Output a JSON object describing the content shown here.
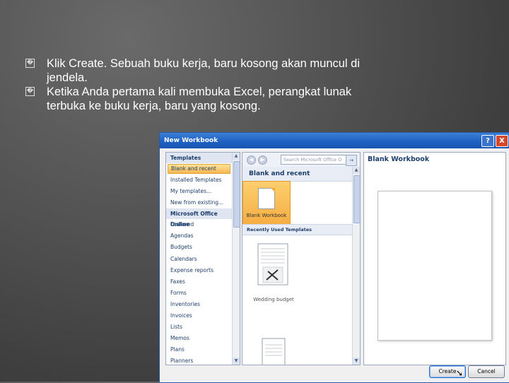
{
  "slide": {
    "bullets": [
      "Klik Create. Sebuah buku kerja, baru kosong akan muncul di jendela.",
      "Ketika Anda pertama kali membuka Excel, perangkat lunak terbuka ke buku kerja, baru yang kosong."
    ],
    "bullet_glyph": "�"
  },
  "dialog": {
    "title": "New Workbook",
    "help_label": "?",
    "close_label": "X",
    "templates": {
      "header": "Templates",
      "items": [
        {
          "label": "Blank and recent",
          "selected": true
        },
        {
          "label": "Installed Templates"
        },
        {
          "label": "My templates..."
        },
        {
          "label": "New from existing..."
        }
      ],
      "online_header": "Microsoft Office Online",
      "online_items": [
        "Featured",
        "Agendas",
        "Budgets",
        "Calendars",
        "Expense reports",
        "Faxes",
        "Forms",
        "Inventories",
        "Invoices",
        "Lists",
        "Memos",
        "Plans",
        "Planners"
      ]
    },
    "middle": {
      "search_placeholder": "Search Microsoft Office O",
      "section_title": "Blank and recent",
      "blank_tile_label": "Blank Workbook",
      "recent_header": "Recently Used Templates",
      "recent_tile_label": "Wedding budget"
    },
    "preview": {
      "title": "Blank Workbook"
    },
    "buttons": {
      "create": "Create",
      "cancel": "Cancel"
    }
  }
}
